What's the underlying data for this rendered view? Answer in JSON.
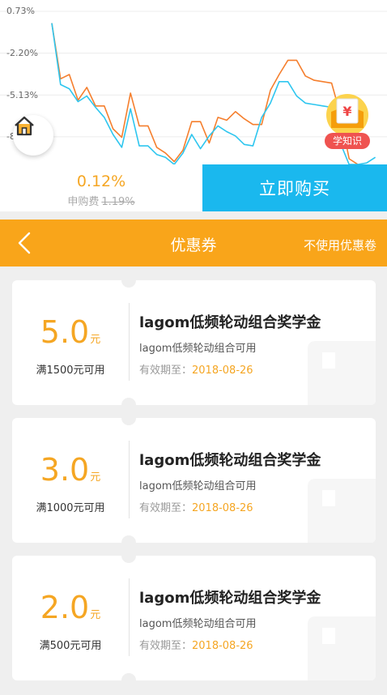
{
  "chart_data": {
    "type": "line",
    "y_tick_labels": [
      "0.73%",
      "-2.20%",
      "-5.13%",
      "-8"
    ],
    "ylim": [
      -10.0,
      0.73
    ],
    "grid": true,
    "colors": {
      "orange": "#f57f2e",
      "blue": "#2ec6ef"
    },
    "series": [
      {
        "color": "orange",
        "values": [
          -0.1,
          -4.0,
          -3.7,
          -5.5,
          -4.6,
          -5.9,
          -5.9,
          -7.5,
          -8.1,
          -5.0,
          -7.3,
          -7.3,
          -8.8,
          -9.2,
          -9.8,
          -9.0,
          -7.0,
          -7.0,
          -8.5,
          -6.7,
          -6.9,
          -6.3,
          -6.8,
          -7.2,
          -7.2,
          -4.8,
          -3.7,
          -2.7,
          -2.7,
          -3.8,
          -4.1,
          -4.2,
          -4.3,
          -6.5,
          -9.6,
          -10.0
        ]
      },
      {
        "color": "blue",
        "values": [
          -0.1,
          -4.4,
          -4.7,
          -5.6,
          -5.2,
          -6.0,
          -6.7,
          -7.9,
          -8.8,
          -6.1,
          -8.7,
          -8.7,
          -9.3,
          -9.5,
          -10.0,
          -9.2,
          -7.9,
          -8.9,
          -8.0,
          -7.3,
          -7.7,
          -8.0,
          -8.6,
          -8.7,
          -6.7,
          -5.7,
          -4.2,
          -4.2,
          -5.2,
          -5.7,
          -5.8,
          -5.9,
          -6.0,
          -8.5,
          -10.0,
          -10.0,
          -9.9,
          -9.5
        ]
      }
    ]
  },
  "icons": {
    "home": "home-icon",
    "learn": "book-icon",
    "back": "chevron-left-icon"
  },
  "learn_badge": {
    "label": "学知识"
  },
  "buy": {
    "fee_rate": "0.12%",
    "fee_label": "申购费",
    "fee_original": "1.19%",
    "button": "立即购买"
  },
  "header": {
    "title": "优惠券",
    "action": "不使用优惠卷"
  },
  "coupons": [
    {
      "amount": "5.0",
      "unit": "元",
      "condition": "满1500元可用",
      "name": "lagom低频轮动组合奖学金",
      "desc": "lagom低频轮动组合可用",
      "expiry_label": "有效期至：",
      "expiry": "2018-08-26"
    },
    {
      "amount": "3.0",
      "unit": "元",
      "condition": "满1000元可用",
      "name": "lagom低频轮动组合奖学金",
      "desc": "lagom低频轮动组合可用",
      "expiry_label": "有效期至：",
      "expiry": "2018-08-26"
    },
    {
      "amount": "2.0",
      "unit": "元",
      "condition": "满500元可用",
      "name": "lagom低频轮动组合奖学金",
      "desc": "lagom低频轮动组合可用",
      "expiry_label": "有效期至：",
      "expiry": "2018-08-26"
    }
  ]
}
